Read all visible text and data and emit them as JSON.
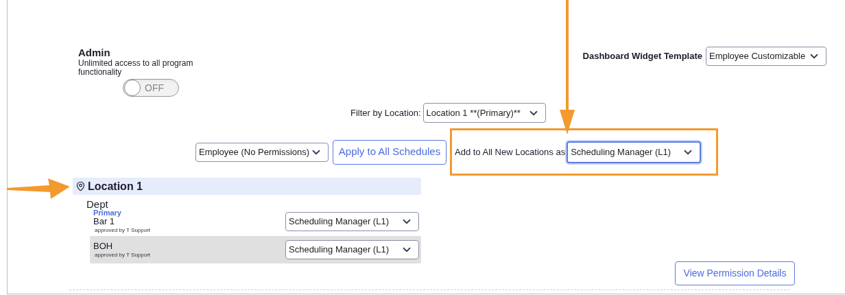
{
  "admin": {
    "title": "Admin",
    "description": "Unlimited access to all program functionality",
    "toggle": {
      "label": "OFF",
      "on": false
    }
  },
  "dashboard_widget_template": {
    "label": "Dashboard Widget Template",
    "value": "Employee Customizable"
  },
  "filter": {
    "label": "Filter by Location:",
    "value": "Location 1 **(Primary)**"
  },
  "bulk_actions": {
    "role_value": "Employee (No Permissions)",
    "apply_button": "Apply to All Schedules",
    "new_locations_label": "Add to All New Locations as",
    "new_locations_value": "Scheduling Manager (L1)",
    "new_locations_focused": true,
    "highlighted": true
  },
  "locations": [
    {
      "name": "Location 1",
      "departments_heading": "Dept",
      "departments": [
        {
          "badge": "Primary",
          "name": "Bar 1",
          "approval": "approved by T Support",
          "role": "Scheduling Manager (L1)",
          "shaded": false
        },
        {
          "name": "BOH",
          "approval": "approved by T Support",
          "role": "Scheduling Manager (L1)",
          "shaded": true
        }
      ]
    }
  ],
  "view_button": "View Permission Details",
  "annotations": [
    {
      "kind": "down"
    },
    {
      "kind": "right"
    }
  ]
}
